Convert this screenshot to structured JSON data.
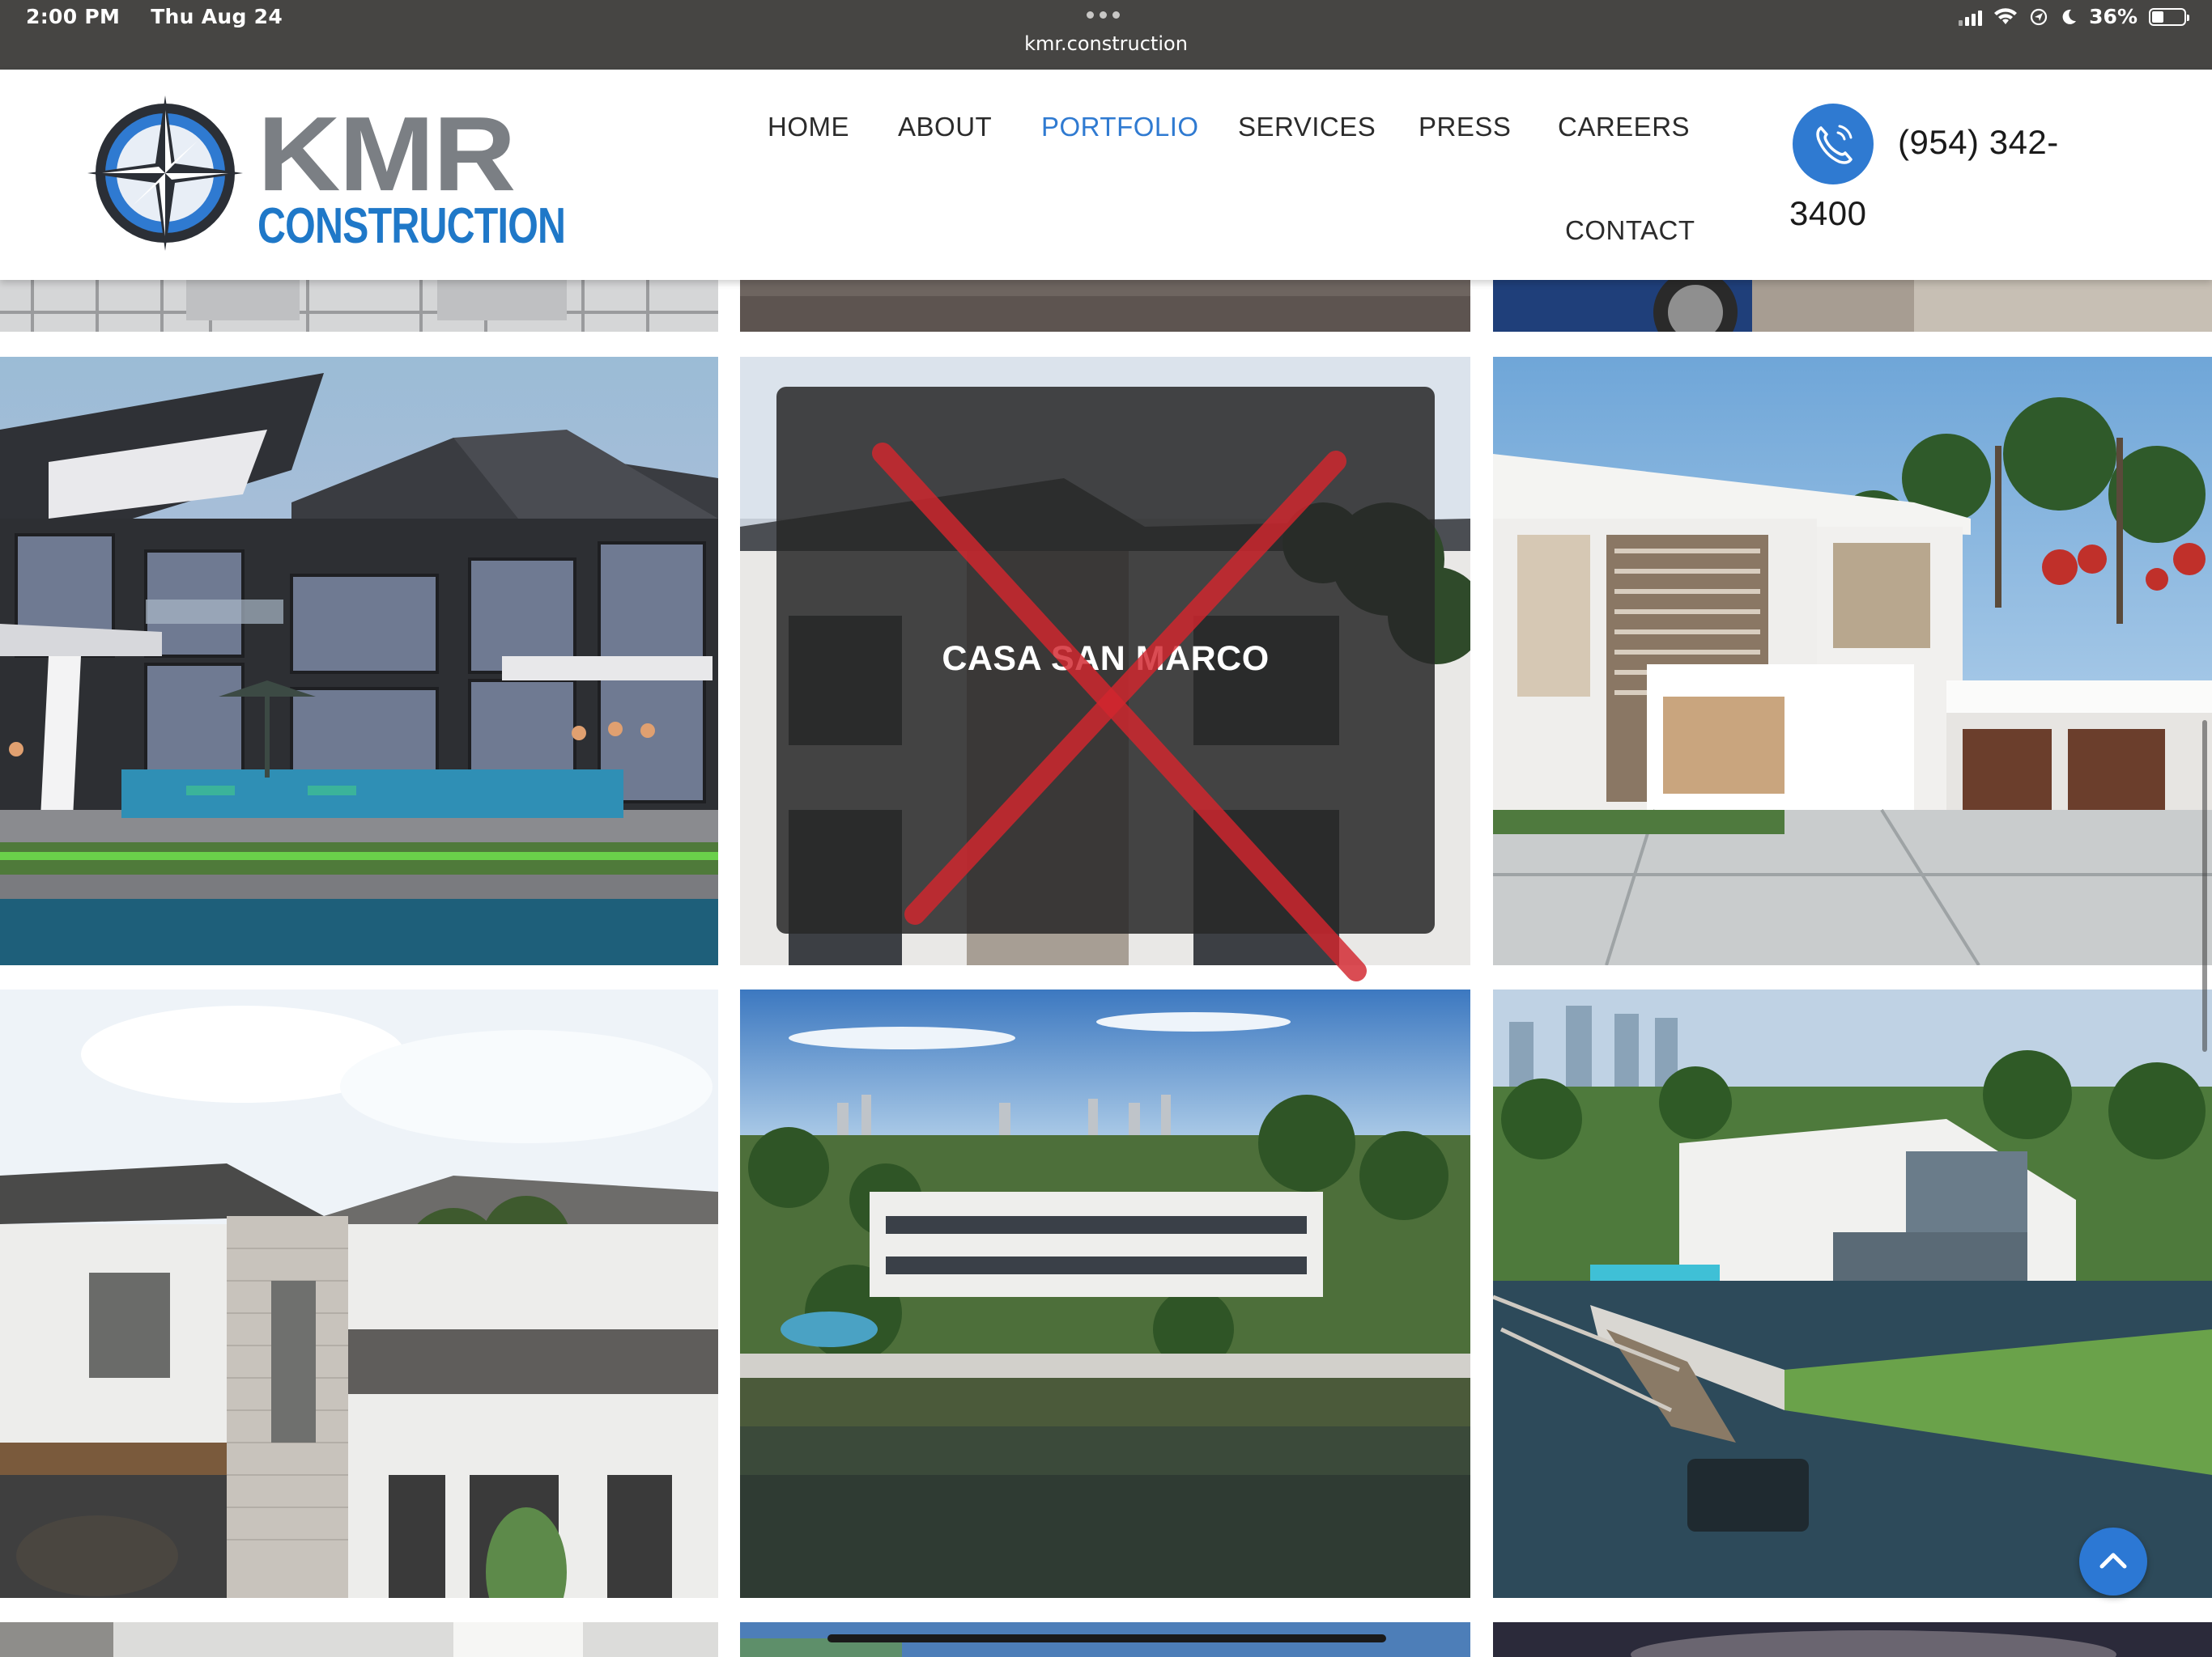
{
  "status_bar": {
    "time": "2:00 PM",
    "date": "Thu Aug 24",
    "url": "kmr.construction",
    "battery": "36%",
    "icons": [
      "signal-icon",
      "wifi-icon",
      "location-icon",
      "moon-icon",
      "battery-icon"
    ]
  },
  "logo": {
    "word": "KMR",
    "subword": "CONSTRUCTION"
  },
  "nav": {
    "items": [
      {
        "label": "HOME",
        "active": false
      },
      {
        "label": "ABOUT",
        "active": false
      },
      {
        "label": "PORTFOLIO",
        "active": true
      },
      {
        "label": "SERVICES",
        "active": false
      },
      {
        "label": "PRESS",
        "active": false
      },
      {
        "label": "CAREERS",
        "active": false
      },
      {
        "label": "CONTACT",
        "active": false
      }
    ]
  },
  "phone": {
    "line1": "(954) 342-",
    "line2": "3400",
    "icon": "phone-icon"
  },
  "gallery": {
    "hover_title": "CASA SAN MARCO",
    "tiles": [
      "architectural-render-waterfront-home",
      "casa-san-marco",
      "modern-white-villa",
      "two-story-white-home",
      "waterfront-estate-aerial",
      "waterfront-home-with-pool"
    ]
  },
  "colors": {
    "status_bar": "#464543",
    "accent": "#2f7ad1",
    "x_mark": "#d3262e"
  }
}
